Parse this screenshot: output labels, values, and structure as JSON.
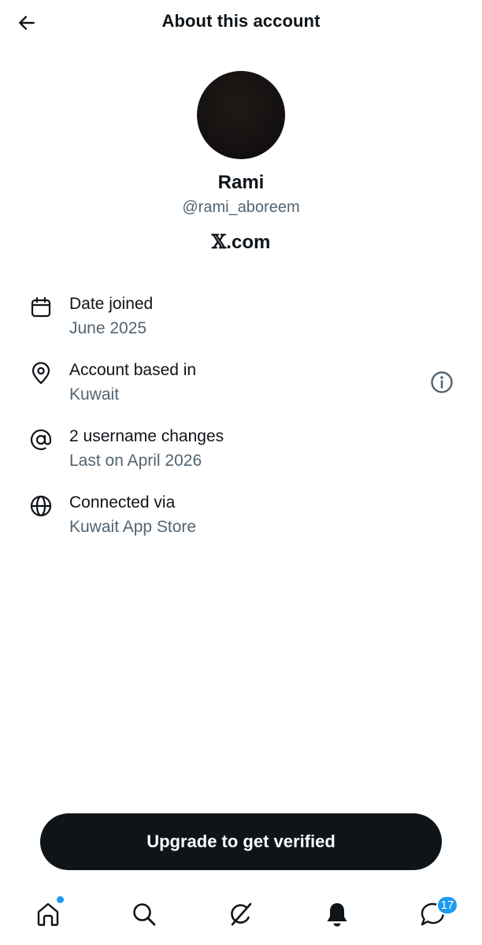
{
  "header": {
    "title": "About this account"
  },
  "profile": {
    "name": "Rami",
    "handle": "@rami_aboreem",
    "source_mark": "𝕏",
    "source_suffix": ".com"
  },
  "details": [
    {
      "icon": "calendar-icon",
      "title": "Date joined",
      "value": "June 2025"
    },
    {
      "icon": "location-pin-icon",
      "title": "Account based in",
      "value": "Kuwait"
    },
    {
      "icon": "at-sign-icon",
      "title": "2 username changes",
      "value": "Last on April 2026"
    },
    {
      "icon": "globe-icon",
      "title": "Connected via",
      "value": "Kuwait App Store"
    }
  ],
  "cta": {
    "label": "Upgrade to get verified"
  },
  "nav": {
    "items": [
      "home-icon",
      "search-icon",
      "grok-icon",
      "notifications-icon",
      "messages-icon"
    ],
    "messages_badge": "17"
  },
  "colors": {
    "text_primary": "#0f1419",
    "text_secondary": "#536471",
    "accent": "#1d9bf0",
    "button_bg": "#0f1419"
  }
}
